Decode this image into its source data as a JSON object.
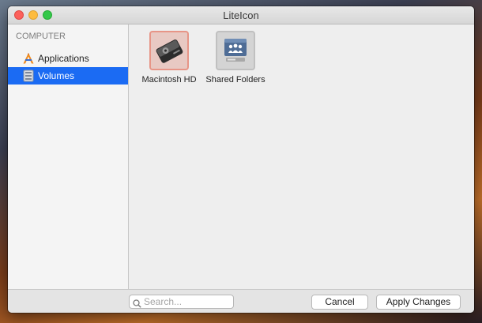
{
  "window": {
    "title": "LiteIcon"
  },
  "sidebar": {
    "section_header": "COMPUTER",
    "items": [
      {
        "label": "Applications",
        "icon": "applications-icon",
        "selected": false
      },
      {
        "label": "Volumes",
        "icon": "volumes-icon",
        "selected": true
      }
    ]
  },
  "volumes": [
    {
      "label": "Macintosh HD",
      "icon": "hard-drive-icon",
      "selected": true
    },
    {
      "label": "Shared Folders",
      "icon": "shared-folders-icon",
      "selected": false
    }
  ],
  "bottom_bar": {
    "search_placeholder": "Search...",
    "search_value": "",
    "cancel_label": "Cancel",
    "apply_label": "Apply Changes"
  },
  "colors": {
    "selection": "#1b6bf3",
    "close": "#fc605b",
    "minimize": "#fdbc40",
    "zoom": "#34c84a",
    "selected_tile_border": "#e79587"
  }
}
